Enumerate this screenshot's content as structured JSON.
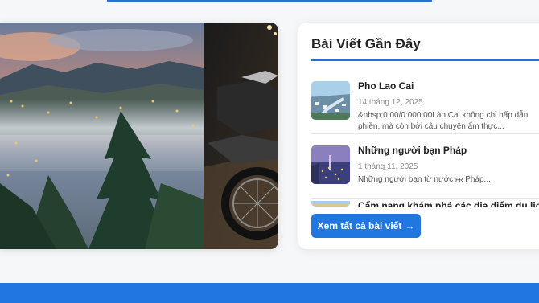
{
  "sidebar": {
    "title": "Bài Viết Gần Đây",
    "posts": [
      {
        "title": "Pho Lao Cai",
        "date": "14 tháng 12, 2025",
        "excerpt": "&nbsp;0:00/0:000:00Lào Cai không chỉ hấp dẫn phiền, mà còn bởi câu chuyện ẩm thực..."
      },
      {
        "title": "Những người bạn Pháp",
        "date": "1 tháng 11, 2025",
        "excerpt": "Những người bạn từ nước",
        "flag": "FR",
        "excerpt_tail": "Pháp..."
      },
      {
        "title": "Cẩm nang khám phá các địa điểm du lịch"
      }
    ],
    "view_all_label": "Xem tất cả bài viết",
    "view_all_arrow": "→"
  },
  "colors": {
    "accent": "#2276e0",
    "rule": "#2b6fd1"
  }
}
